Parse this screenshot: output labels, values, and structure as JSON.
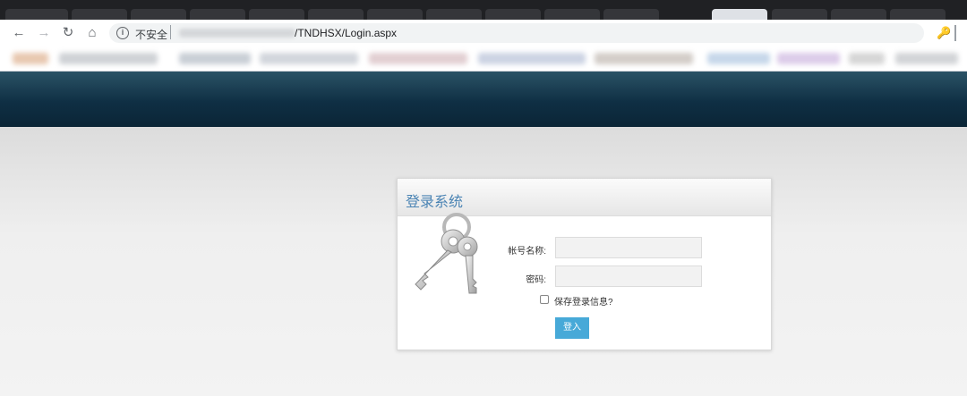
{
  "browser": {
    "security_label": "不安全",
    "url_path": "/TNDHSX/Login.aspx"
  },
  "login": {
    "title": "登录系统",
    "username_label": "帐号名称:",
    "password_label": "密码:",
    "remember_label": "保存登录信息?",
    "submit_label": "登入",
    "username_value": "",
    "password_value": ""
  }
}
